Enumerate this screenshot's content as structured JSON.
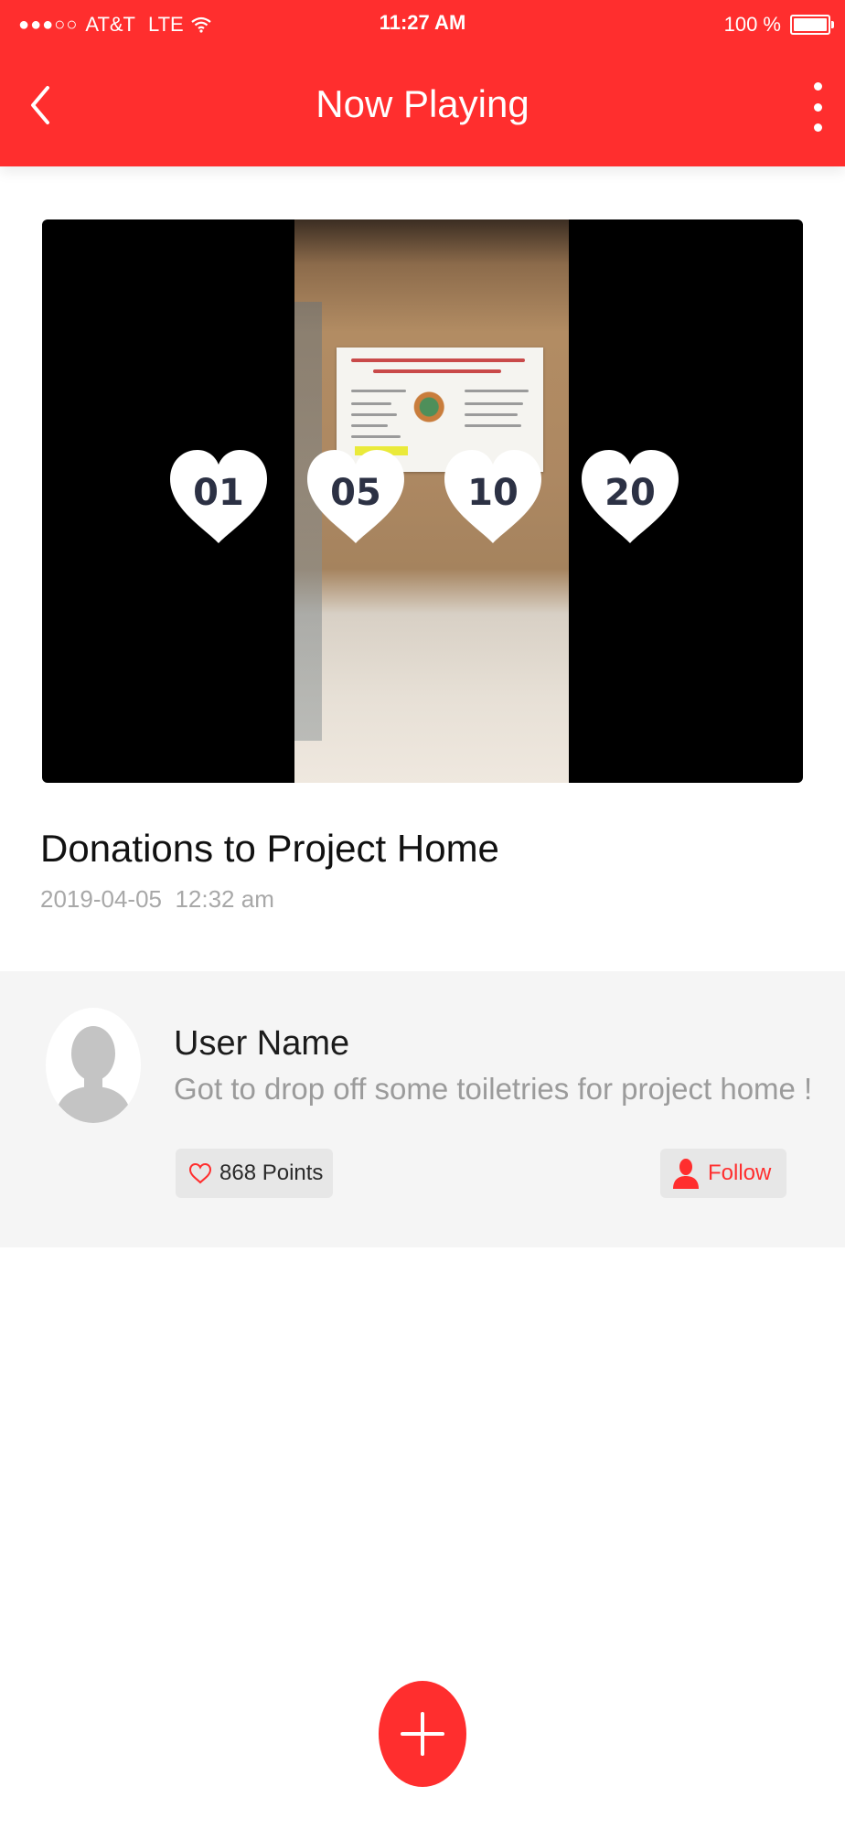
{
  "status_bar": {
    "signal": "●●●○○",
    "carrier": "AT&T",
    "network": "LTE",
    "time": "11:27 AM",
    "battery": "100 %"
  },
  "nav": {
    "title": "Now Playing",
    "back_icon": "chevron-left-icon",
    "more_icon": "more-vertical-icon"
  },
  "video": {
    "reward_options": [
      "01",
      "05",
      "10",
      "20"
    ]
  },
  "post": {
    "title": "Donations to Project Home",
    "date": "2019-04-05",
    "time": "12:32 am"
  },
  "comment": {
    "user_name": "User Name",
    "text": "Got to drop off some toiletries for project home !",
    "points_label": "868 Points",
    "follow_label": "Follow"
  },
  "colors": {
    "accent": "#ff2e2e",
    "card_bg": "#f5f5f5",
    "muted_text": "#9b9b9b"
  }
}
